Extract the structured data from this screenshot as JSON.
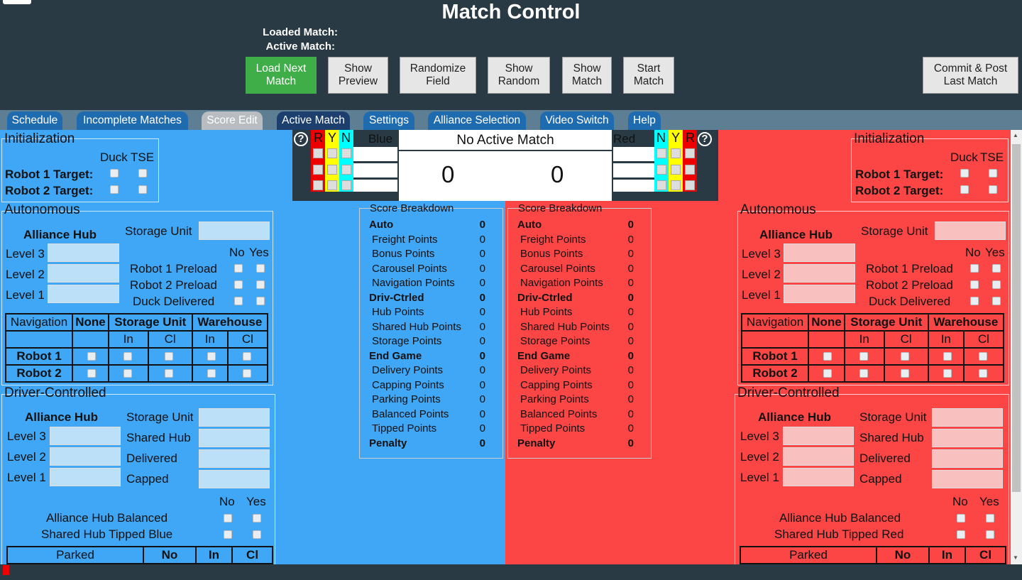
{
  "header": {
    "title": "Match Control",
    "loaded_match": "Loaded Match:",
    "active_match": "Active Match:"
  },
  "buttons": {
    "load_next": "Load Next Match",
    "show_preview": "Show Preview",
    "randomize": "Randomize Field",
    "show_random": "Show Random",
    "show_match": "Show Match",
    "start_match": "Start Match",
    "commit_post": "Commit & Post Last Match"
  },
  "tabs": [
    "Schedule",
    "Incomplete Matches",
    "Score Edit",
    "Active Match",
    "Settings",
    "Alliance Selection",
    "Video Switch",
    "Help"
  ],
  "score": {
    "no_active": "No Active Match",
    "blue_label": "Blue",
    "red_label": "Red",
    "blue_score": "0",
    "red_score": "0",
    "r": "R",
    "y": "Y",
    "n": "N",
    "help": "?"
  },
  "init": {
    "legend": "Initialization",
    "duck": "Duck",
    "tse": "TSE",
    "r1": "Robot 1 Target:",
    "r2": "Robot 2 Target:"
  },
  "auto": {
    "legend": "Autonomous",
    "hub": "Alliance Hub",
    "storage": "Storage Unit",
    "l3": "Level 3",
    "l2": "Level 2",
    "l1": "Level 1",
    "no": "No",
    "yes": "Yes",
    "r1p": "Robot 1 Preload",
    "r2p": "Robot 2 Preload",
    "duck": "Duck Delivered"
  },
  "nav": {
    "navigation": "Navigation",
    "none": "None",
    "storage": "Storage Unit",
    "warehouse": "Warehouse",
    "in": "In",
    "cl": "Cl",
    "r1": "Robot 1",
    "r2": "Robot 2"
  },
  "driver": {
    "legend": "Driver-Controlled",
    "hub": "Alliance Hub",
    "storage": "Storage Unit",
    "shared": "Shared Hub",
    "delivered": "Delivered",
    "capped": "Capped",
    "l3": "Level 3",
    "l2": "Level 2",
    "l1": "Level 1",
    "no": "No",
    "yes": "Yes",
    "balanced": "Alliance Hub Balanced",
    "tipped_blue": "Shared Hub Tipped Blue",
    "tipped_red": "Shared Hub Tipped Red",
    "parked": "Parked",
    "pno": "No",
    "pin": "In",
    "pcl": "Cl"
  },
  "breakdown": {
    "legend": "Score Breakdown",
    "rows": [
      {
        "k": "Auto",
        "v": "0",
        "bold": true
      },
      {
        "k": "Freight Points",
        "v": "0"
      },
      {
        "k": "Bonus Points",
        "v": "0"
      },
      {
        "k": "Carousel Points",
        "v": "0"
      },
      {
        "k": "Navigation Points",
        "v": "0"
      },
      {
        "k": "Driv-Ctrled",
        "v": "0",
        "bold": true
      },
      {
        "k": "Hub Points",
        "v": "0"
      },
      {
        "k": "Shared Hub Points",
        "v": "0"
      },
      {
        "k": "Storage Points",
        "v": "0"
      },
      {
        "k": "End Game",
        "v": "0",
        "bold": true
      },
      {
        "k": "Delivery Points",
        "v": "0"
      },
      {
        "k": "Capping Points",
        "v": "0"
      },
      {
        "k": "Parking Points",
        "v": "0"
      },
      {
        "k": "Balanced Points",
        "v": "0"
      },
      {
        "k": "Tipped Points",
        "v": "0"
      },
      {
        "k": "Penalty",
        "v": "0",
        "bold": true
      }
    ]
  },
  "colors": {
    "blue": "#3fa7f5",
    "red": "#fc4646",
    "dark": "#2a3a44",
    "green": "#3fae48"
  }
}
